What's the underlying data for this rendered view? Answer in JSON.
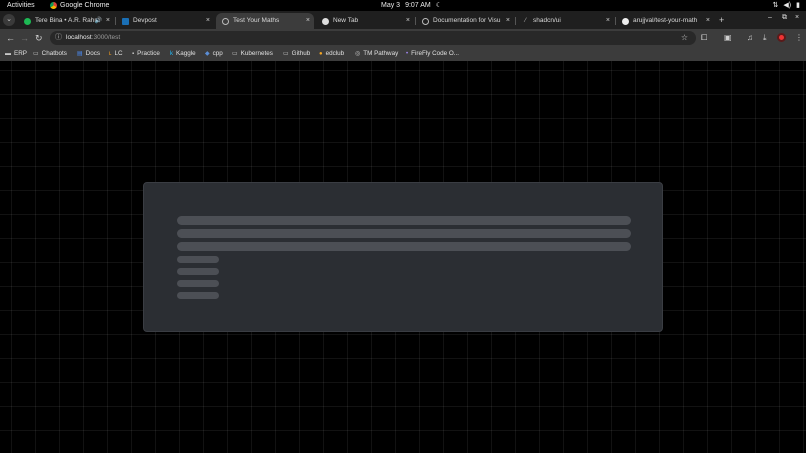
{
  "topbar": {
    "activities": "Activities",
    "app_name": "Google Chrome",
    "date": "May 3",
    "time": "9:07 AM"
  },
  "tabs": [
    {
      "label": "Tere Bina • A.R. Rahm",
      "active": false,
      "icon": "spotify-icon",
      "playing_audio": true
    },
    {
      "label": "Devpost",
      "active": false,
      "icon": "devpost-icon"
    },
    {
      "label": "Test Your Maths",
      "active": true,
      "icon": "globe-icon"
    },
    {
      "label": "New Tab",
      "active": false,
      "icon": "chrome-icon"
    },
    {
      "label": "Documentation for Visu",
      "active": false,
      "icon": "globe-icon"
    },
    {
      "label": "shadcn/ui",
      "active": false,
      "icon": "shadcn-icon"
    },
    {
      "label": "arujjval/test-your-math",
      "active": false,
      "icon": "github-icon"
    }
  ],
  "toolbar": {
    "url_host": "localhost",
    "url_path": ":3000/test"
  },
  "bookmarks": [
    {
      "label": "ERP",
      "icon": "erp-icon"
    },
    {
      "label": "Chatbots",
      "icon": "folder-icon"
    },
    {
      "label": "Docs",
      "icon": "docs-icon"
    },
    {
      "label": "LC",
      "icon": "leetcode-icon"
    },
    {
      "label": "Practice",
      "icon": "practice-icon"
    },
    {
      "label": "Kaggle",
      "icon": "kaggle-icon"
    },
    {
      "label": "cpp",
      "icon": "cpp-icon"
    },
    {
      "label": "Kubernetes",
      "icon": "folder-icon"
    },
    {
      "label": "Github",
      "icon": "folder-icon"
    },
    {
      "label": "edclub",
      "icon": "edclub-icon"
    },
    {
      "label": "TM Pathway",
      "icon": "toastmasters-icon"
    },
    {
      "label": "FireFly Code O...",
      "icon": "firefly-icon"
    }
  ],
  "colors": {
    "page_bg": "#000000",
    "card_bg": "#2b2e33",
    "skeleton": "#4c4f55",
    "chrome_toolbar": "#3c3c3c"
  },
  "loading_skeleton": {
    "wide_lines": 3,
    "short_lines": 4
  }
}
